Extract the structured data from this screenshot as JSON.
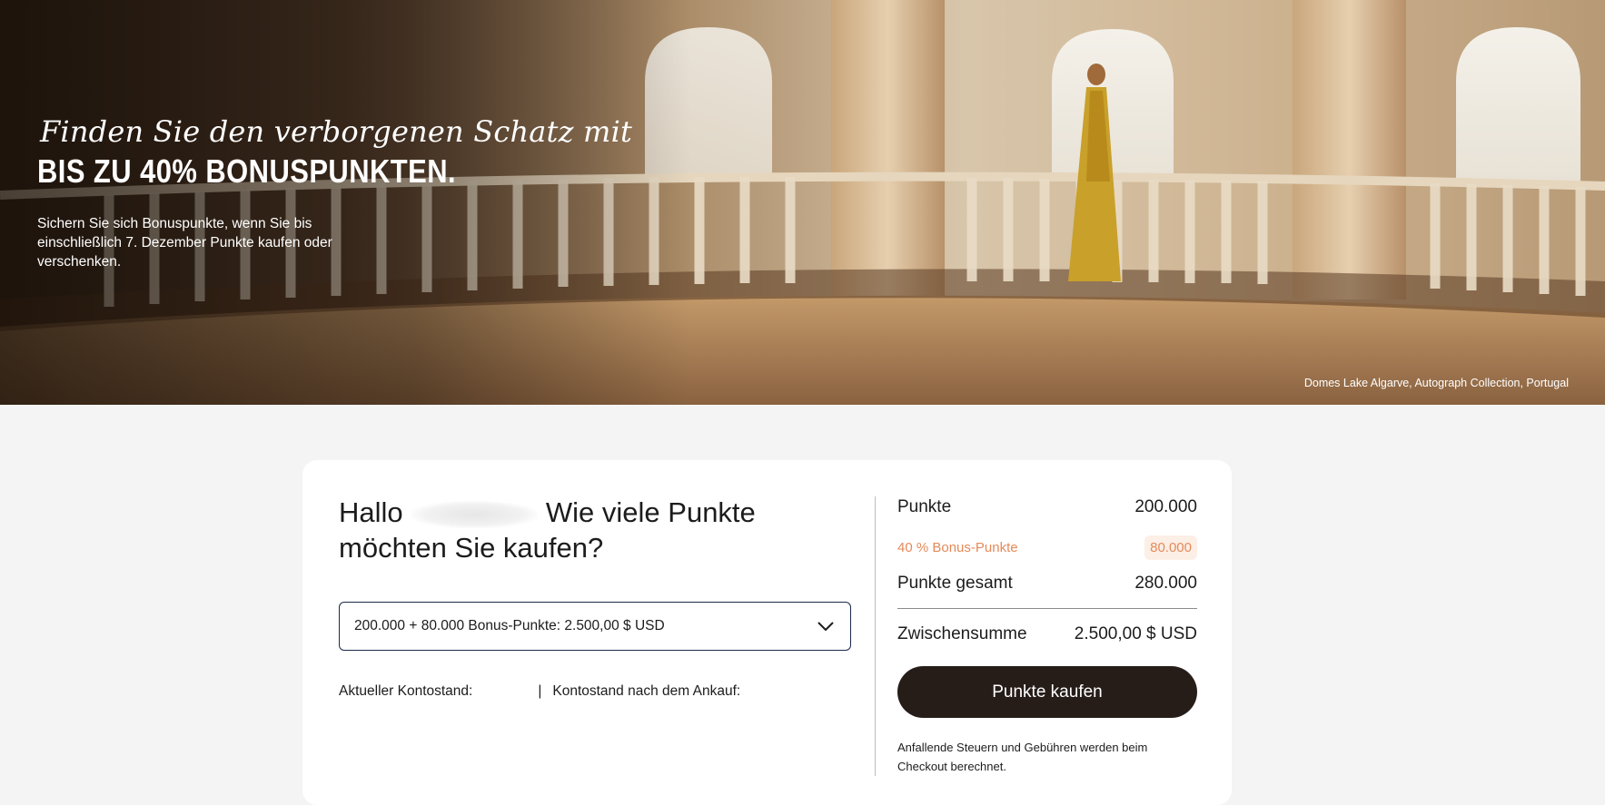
{
  "hero": {
    "title_italic": "Finden Sie den verborgenen Schatz mit",
    "title_bold": "BIS ZU 40% BONUSPUNKTEN.",
    "description": "Sichern Sie sich Bonuspunkte, wenn Sie bis einschließlich 7.  Dezember Punkte kaufen oder verschenken.",
    "caption": "Domes Lake Algarve, Autograph Collection, Portugal"
  },
  "purchase": {
    "greeting_hello": "Hallo",
    "greeting_question": "Wie viele Punkte möchten Sie kaufen?",
    "select_value": "200.000 + 80.000 Bonus-Punkte: 2.500,00 $ USD",
    "current_balance_label": "Aktueller Kontostand:",
    "separator": "|",
    "after_balance_label": "Kontostand nach dem Ankauf:"
  },
  "summary": {
    "points_label": "Punkte",
    "points_value": "200.000",
    "bonus_label": "40  % Bonus-Punkte",
    "bonus_value": "80.000",
    "total_label": "Punkte gesamt",
    "total_value": "280.000",
    "subtotal_label": "Zwischensumme",
    "subtotal_value": "2.500,00 $ USD",
    "buy_button": "Punkte kaufen",
    "note": "Anfallende Steuern und Gebühren werden beim Checkout berechnet."
  },
  "colors": {
    "button_bg": "#261d19",
    "bonus_accent": "#e58a5a",
    "select_border": "#1c2a4a"
  }
}
